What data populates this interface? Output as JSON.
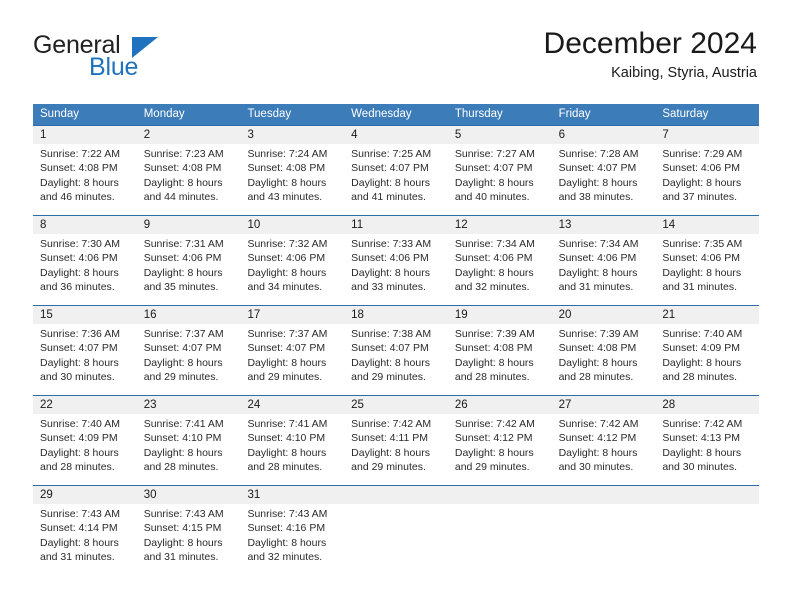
{
  "brand": {
    "word1": "General",
    "word2": "Blue",
    "logo_icon": "triangle-logo-icon",
    "accent_color": "#1f72bd"
  },
  "header": {
    "title": "December 2024",
    "location": "Kaibing, Styria, Austria"
  },
  "theme": {
    "header_bg": "#3c7cb8",
    "header_text": "#ffffff",
    "daynum_bg": "#f0f0f0",
    "row_rule": "#2f6da8",
    "body_text": "#2a2a2a"
  },
  "calendar": {
    "weekdays": [
      "Sunday",
      "Monday",
      "Tuesday",
      "Wednesday",
      "Thursday",
      "Friday",
      "Saturday"
    ],
    "weeks": [
      {
        "days": [
          {
            "num": "1",
            "sunrise": "Sunrise: 7:22 AM",
            "sunset": "Sunset: 4:08 PM",
            "daylight1": "Daylight: 8 hours",
            "daylight2": "and 46 minutes."
          },
          {
            "num": "2",
            "sunrise": "Sunrise: 7:23 AM",
            "sunset": "Sunset: 4:08 PM",
            "daylight1": "Daylight: 8 hours",
            "daylight2": "and 44 minutes."
          },
          {
            "num": "3",
            "sunrise": "Sunrise: 7:24 AM",
            "sunset": "Sunset: 4:08 PM",
            "daylight1": "Daylight: 8 hours",
            "daylight2": "and 43 minutes."
          },
          {
            "num": "4",
            "sunrise": "Sunrise: 7:25 AM",
            "sunset": "Sunset: 4:07 PM",
            "daylight1": "Daylight: 8 hours",
            "daylight2": "and 41 minutes."
          },
          {
            "num": "5",
            "sunrise": "Sunrise: 7:27 AM",
            "sunset": "Sunset: 4:07 PM",
            "daylight1": "Daylight: 8 hours",
            "daylight2": "and 40 minutes."
          },
          {
            "num": "6",
            "sunrise": "Sunrise: 7:28 AM",
            "sunset": "Sunset: 4:07 PM",
            "daylight1": "Daylight: 8 hours",
            "daylight2": "and 38 minutes."
          },
          {
            "num": "7",
            "sunrise": "Sunrise: 7:29 AM",
            "sunset": "Sunset: 4:06 PM",
            "daylight1": "Daylight: 8 hours",
            "daylight2": "and 37 minutes."
          }
        ]
      },
      {
        "days": [
          {
            "num": "8",
            "sunrise": "Sunrise: 7:30 AM",
            "sunset": "Sunset: 4:06 PM",
            "daylight1": "Daylight: 8 hours",
            "daylight2": "and 36 minutes."
          },
          {
            "num": "9",
            "sunrise": "Sunrise: 7:31 AM",
            "sunset": "Sunset: 4:06 PM",
            "daylight1": "Daylight: 8 hours",
            "daylight2": "and 35 minutes."
          },
          {
            "num": "10",
            "sunrise": "Sunrise: 7:32 AM",
            "sunset": "Sunset: 4:06 PM",
            "daylight1": "Daylight: 8 hours",
            "daylight2": "and 34 minutes."
          },
          {
            "num": "11",
            "sunrise": "Sunrise: 7:33 AM",
            "sunset": "Sunset: 4:06 PM",
            "daylight1": "Daylight: 8 hours",
            "daylight2": "and 33 minutes."
          },
          {
            "num": "12",
            "sunrise": "Sunrise: 7:34 AM",
            "sunset": "Sunset: 4:06 PM",
            "daylight1": "Daylight: 8 hours",
            "daylight2": "and 32 minutes."
          },
          {
            "num": "13",
            "sunrise": "Sunrise: 7:34 AM",
            "sunset": "Sunset: 4:06 PM",
            "daylight1": "Daylight: 8 hours",
            "daylight2": "and 31 minutes."
          },
          {
            "num": "14",
            "sunrise": "Sunrise: 7:35 AM",
            "sunset": "Sunset: 4:06 PM",
            "daylight1": "Daylight: 8 hours",
            "daylight2": "and 31 minutes."
          }
        ]
      },
      {
        "days": [
          {
            "num": "15",
            "sunrise": "Sunrise: 7:36 AM",
            "sunset": "Sunset: 4:07 PM",
            "daylight1": "Daylight: 8 hours",
            "daylight2": "and 30 minutes."
          },
          {
            "num": "16",
            "sunrise": "Sunrise: 7:37 AM",
            "sunset": "Sunset: 4:07 PM",
            "daylight1": "Daylight: 8 hours",
            "daylight2": "and 29 minutes."
          },
          {
            "num": "17",
            "sunrise": "Sunrise: 7:37 AM",
            "sunset": "Sunset: 4:07 PM",
            "daylight1": "Daylight: 8 hours",
            "daylight2": "and 29 minutes."
          },
          {
            "num": "18",
            "sunrise": "Sunrise: 7:38 AM",
            "sunset": "Sunset: 4:07 PM",
            "daylight1": "Daylight: 8 hours",
            "daylight2": "and 29 minutes."
          },
          {
            "num": "19",
            "sunrise": "Sunrise: 7:39 AM",
            "sunset": "Sunset: 4:08 PM",
            "daylight1": "Daylight: 8 hours",
            "daylight2": "and 28 minutes."
          },
          {
            "num": "20",
            "sunrise": "Sunrise: 7:39 AM",
            "sunset": "Sunset: 4:08 PM",
            "daylight1": "Daylight: 8 hours",
            "daylight2": "and 28 minutes."
          },
          {
            "num": "21",
            "sunrise": "Sunrise: 7:40 AM",
            "sunset": "Sunset: 4:09 PM",
            "daylight1": "Daylight: 8 hours",
            "daylight2": "and 28 minutes."
          }
        ]
      },
      {
        "days": [
          {
            "num": "22",
            "sunrise": "Sunrise: 7:40 AM",
            "sunset": "Sunset: 4:09 PM",
            "daylight1": "Daylight: 8 hours",
            "daylight2": "and 28 minutes."
          },
          {
            "num": "23",
            "sunrise": "Sunrise: 7:41 AM",
            "sunset": "Sunset: 4:10 PM",
            "daylight1": "Daylight: 8 hours",
            "daylight2": "and 28 minutes."
          },
          {
            "num": "24",
            "sunrise": "Sunrise: 7:41 AM",
            "sunset": "Sunset: 4:10 PM",
            "daylight1": "Daylight: 8 hours",
            "daylight2": "and 28 minutes."
          },
          {
            "num": "25",
            "sunrise": "Sunrise: 7:42 AM",
            "sunset": "Sunset: 4:11 PM",
            "daylight1": "Daylight: 8 hours",
            "daylight2": "and 29 minutes."
          },
          {
            "num": "26",
            "sunrise": "Sunrise: 7:42 AM",
            "sunset": "Sunset: 4:12 PM",
            "daylight1": "Daylight: 8 hours",
            "daylight2": "and 29 minutes."
          },
          {
            "num": "27",
            "sunrise": "Sunrise: 7:42 AM",
            "sunset": "Sunset: 4:12 PM",
            "daylight1": "Daylight: 8 hours",
            "daylight2": "and 30 minutes."
          },
          {
            "num": "28",
            "sunrise": "Sunrise: 7:42 AM",
            "sunset": "Sunset: 4:13 PM",
            "daylight1": "Daylight: 8 hours",
            "daylight2": "and 30 minutes."
          }
        ]
      },
      {
        "days": [
          {
            "num": "29",
            "sunrise": "Sunrise: 7:43 AM",
            "sunset": "Sunset: 4:14 PM",
            "daylight1": "Daylight: 8 hours",
            "daylight2": "and 31 minutes."
          },
          {
            "num": "30",
            "sunrise": "Sunrise: 7:43 AM",
            "sunset": "Sunset: 4:15 PM",
            "daylight1": "Daylight: 8 hours",
            "daylight2": "and 31 minutes."
          },
          {
            "num": "31",
            "sunrise": "Sunrise: 7:43 AM",
            "sunset": "Sunset: 4:16 PM",
            "daylight1": "Daylight: 8 hours",
            "daylight2": "and 32 minutes."
          },
          {
            "num": "",
            "sunrise": "",
            "sunset": "",
            "daylight1": "",
            "daylight2": ""
          },
          {
            "num": "",
            "sunrise": "",
            "sunset": "",
            "daylight1": "",
            "daylight2": ""
          },
          {
            "num": "",
            "sunrise": "",
            "sunset": "",
            "daylight1": "",
            "daylight2": ""
          },
          {
            "num": "",
            "sunrise": "",
            "sunset": "",
            "daylight1": "",
            "daylight2": ""
          }
        ]
      }
    ]
  }
}
